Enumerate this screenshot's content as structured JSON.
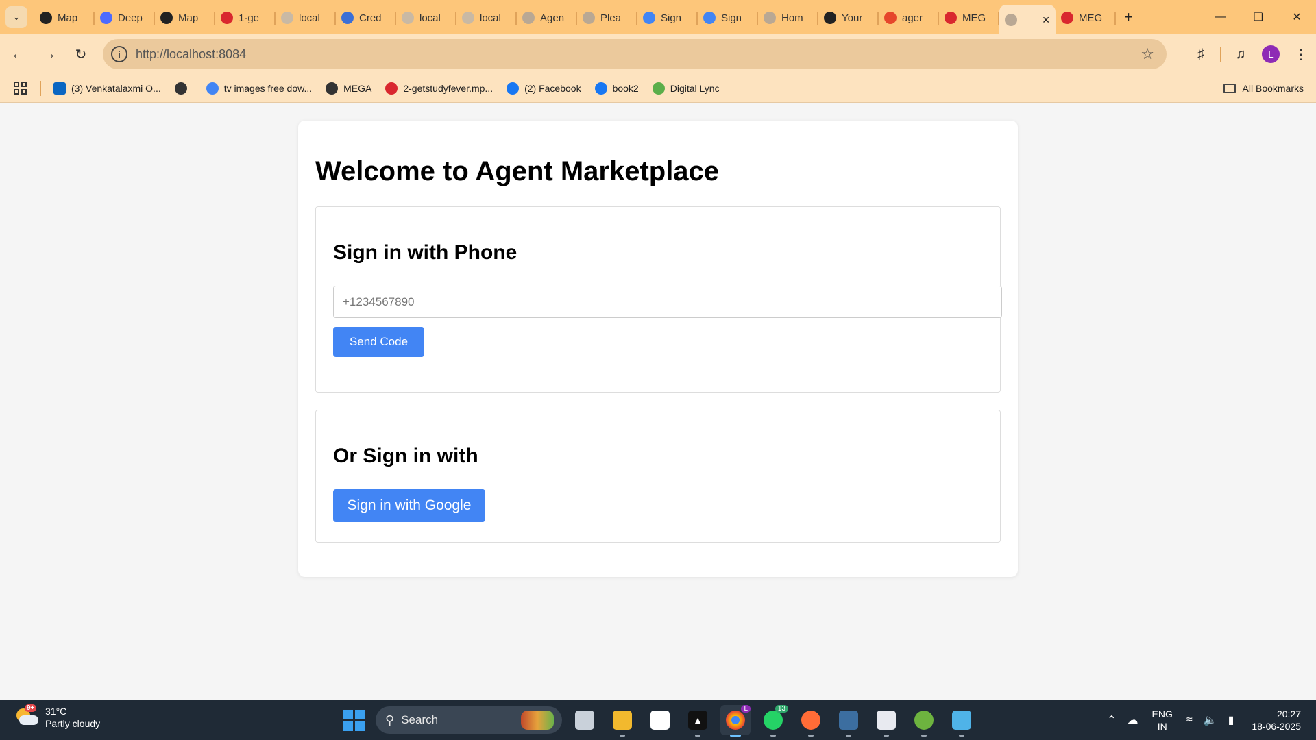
{
  "browser": {
    "tabs": [
      {
        "title": "Map",
        "icon": "openai-icon",
        "color": "#222222"
      },
      {
        "title": "Deep",
        "icon": "deepseek-icon",
        "color": "#4d6bfe"
      },
      {
        "title": "Map",
        "icon": "openai-icon",
        "color": "#222222"
      },
      {
        "title": "1-ge",
        "icon": "mega-icon",
        "color": "#d9272e"
      },
      {
        "title": "local",
        "icon": "globe-icon",
        "color": "#c9b9a4"
      },
      {
        "title": "Cred",
        "icon": "api-icon",
        "color": "#3b6fd6"
      },
      {
        "title": "local",
        "icon": "globe-icon",
        "color": "#c9b9a4"
      },
      {
        "title": "local",
        "icon": "globe-icon",
        "color": "#c9b9a4"
      },
      {
        "title": "Agen",
        "icon": "globe-icon",
        "color": "#b9a894"
      },
      {
        "title": "Plea",
        "icon": "globe-icon",
        "color": "#b9a894"
      },
      {
        "title": "Sign",
        "icon": "google-icon",
        "color": "#4285f4"
      },
      {
        "title": "Sign",
        "icon": "google-icon",
        "color": "#4285f4"
      },
      {
        "title": "Hom",
        "icon": "globe-icon",
        "color": "#b9a894"
      },
      {
        "title": "Your",
        "icon": "github-icon",
        "color": "#222222"
      },
      {
        "title": "ager",
        "icon": "flame-icon",
        "color": "#e6462b"
      },
      {
        "title": "MEG",
        "icon": "mega-icon",
        "color": "#d9272e"
      },
      {
        "title": "",
        "icon": "globe-icon",
        "color": "#b9a894",
        "active": true
      },
      {
        "title": "MEG",
        "icon": "mega-icon",
        "color": "#d9272e"
      }
    ],
    "url": "http://localhost:8084",
    "profile_initial": "L",
    "bookmarks": [
      {
        "label": "(3) Venkatalaxmi O...",
        "icon": "linkedin-icon",
        "color": "#0a66c2"
      },
      {
        "label": "",
        "icon": "globe-icon",
        "color": "#333333"
      },
      {
        "label": "tv images free dow...",
        "icon": "google-icon",
        "color": "#4285f4"
      },
      {
        "label": "MEGA",
        "icon": "globe-icon",
        "color": "#333333"
      },
      {
        "label": "2-getstudyfever.mp...",
        "icon": "mega-icon",
        "color": "#d9272e"
      },
      {
        "label": "(2) Facebook",
        "icon": "facebook-icon",
        "color": "#1877f2"
      },
      {
        "label": "book2",
        "icon": "facebook-icon",
        "color": "#1877f2"
      },
      {
        "label": "Digital Lync",
        "icon": "digital-lync-icon",
        "color": "#5bae4a"
      }
    ],
    "all_bookmarks_label": "All Bookmarks"
  },
  "page": {
    "title": "Welcome to Agent Marketplace",
    "phone_section": {
      "heading": "Sign in with Phone",
      "placeholder": "+1234567890",
      "button": "Send Code"
    },
    "social_section": {
      "heading": "Or Sign in with",
      "button": "Sign in with Google"
    },
    "accent_color": "#4285f4"
  },
  "taskbar": {
    "weather": {
      "temp": "31°C",
      "condition": "Partly cloudy",
      "badge": "9+"
    },
    "search_label": "Search",
    "chrome_badge": "L",
    "whatsapp_badge": "13",
    "lang": {
      "line1": "ENG",
      "line2": "IN"
    },
    "clock": {
      "time": "20:27",
      "date": "18-06-2025"
    }
  }
}
